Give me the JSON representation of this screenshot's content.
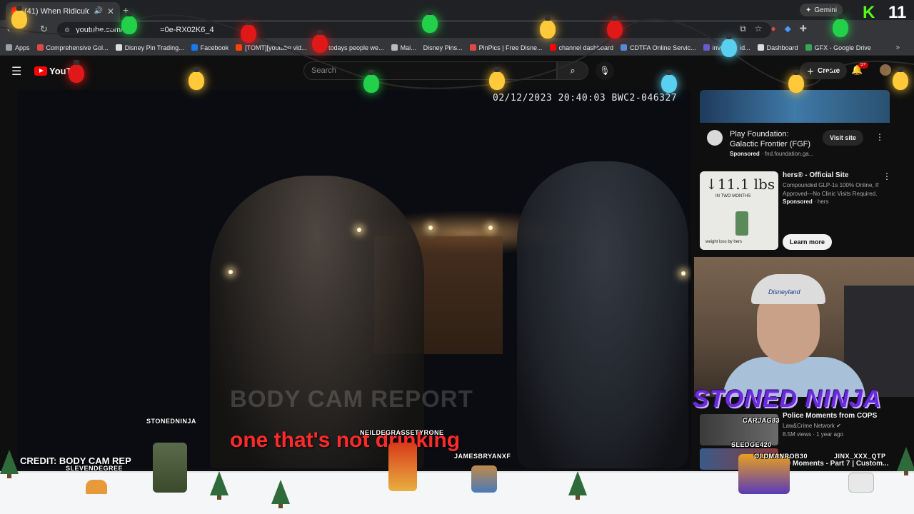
{
  "browser": {
    "tab_title": "(41) When Ridiculous Karen",
    "address": "youtube.com/w",
    "address_suffix": "=0e-RX02K6_4",
    "gemini_label": "Gemini",
    "bookmarks": [
      "Apps",
      "Comprehensive Gol...",
      "Disney Pin Trading...",
      "Facebook",
      "[TOMT][youtube vid...",
      "If todays people we...",
      "Mai...",
      "Disney Pins...",
      "PinPics | Free Disne...",
      "channel dashboard",
      "CDTFA Online Servic...",
      "invideo",
      "id...",
      "Dashboard",
      "GFX - Google Drive"
    ]
  },
  "youtube": {
    "logo_text": "YouT",
    "search_placeholder": "Search",
    "create_label": "Create",
    "notif_count": "9+"
  },
  "video": {
    "timestamp": "02/12/2023 20:40:03 BWC2-046327",
    "watermark": "BODY CAM REPORT",
    "caption": "one that's not drinking",
    "credit": "CREDIT: BODY CAM REP"
  },
  "sidebar": {
    "ad1": {
      "title": "Play Foundation: Galactic Frontier (FGF)",
      "sponsored": "Sponsored",
      "domain": "fnd.foundation.ga...",
      "button": "Visit site"
    },
    "ad2": {
      "title": "hers® - Official Site",
      "desc": "Compounded GLP-1s 100% Online, If Approved—No Clinic Visits Required.",
      "sponsored": "Sponsored",
      "source": "hers",
      "button": "Learn more",
      "thumb_big": "↓11.1 lbs",
      "thumb_small": "IN TWO MONTHS",
      "thumb_foot": "weight loss by hers"
    },
    "webcam_cap": "Disneyland",
    "rec1": {
      "title": "Police Moments from COPS",
      "channel": "Law&Crime Network",
      "views": "8.5M views · 1 year ago"
    },
    "rec2": {
      "title": "10 Moments - Part 7 | Custom..."
    }
  },
  "overlay": {
    "brand": "STONED NINJA",
    "k_logo": "K",
    "k_count": "11",
    "chatters": [
      "STONEDNINJA",
      "SLEVENDEGREE",
      "NEILDEGRASSETYRONE",
      "JAMESBRYANXF",
      "CARJAG83",
      "SLEDGE420",
      "OLDMANROB30",
      "JINX_XXX_QTP"
    ]
  },
  "colors": {
    "youtube_red": "#ff0000",
    "caption_red": "#ff2a2a",
    "brand_purple": "#6a2cd9",
    "kick_green": "#53fc18"
  }
}
